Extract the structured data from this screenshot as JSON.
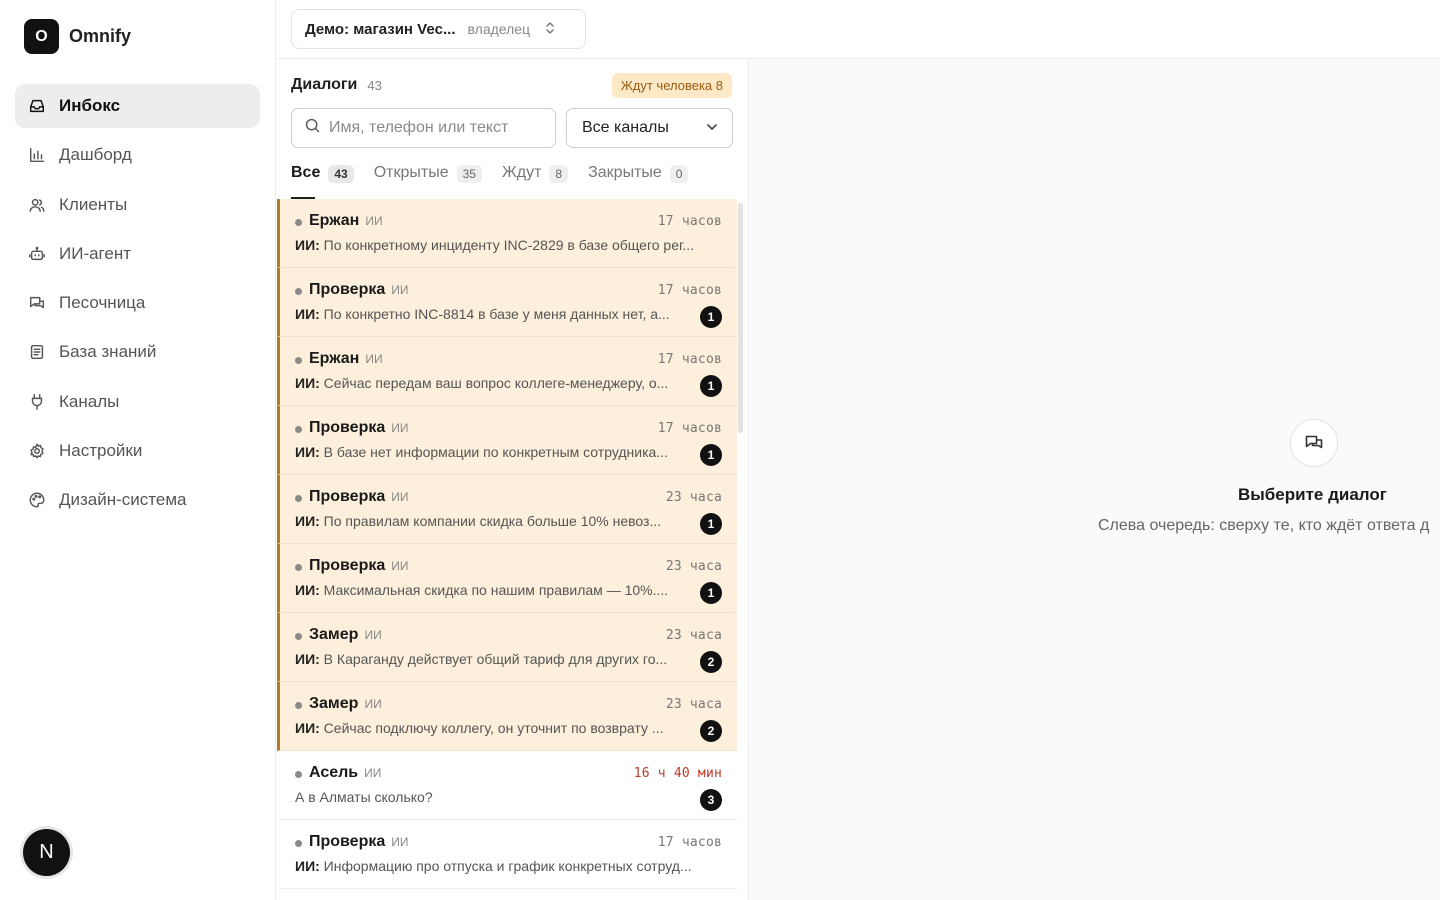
{
  "brand": {
    "logo_letter": "O",
    "name": "Omnify"
  },
  "nav": [
    {
      "label": "Инбокс",
      "icon": "inbox-icon",
      "active": true
    },
    {
      "label": "Дашборд",
      "icon": "chart-icon"
    },
    {
      "label": "Клиенты",
      "icon": "users-icon"
    },
    {
      "label": "ИИ-агент",
      "icon": "bot-icon"
    },
    {
      "label": "Песочница",
      "icon": "chat-icon"
    },
    {
      "label": "База знаний",
      "icon": "book-icon"
    },
    {
      "label": "Каналы",
      "icon": "plug-icon"
    },
    {
      "label": "Настройки",
      "icon": "gear-icon"
    },
    {
      "label": "Дизайн-система",
      "icon": "palette-icon"
    }
  ],
  "user": {
    "avatar_letter": "N"
  },
  "org": {
    "name": "Демо: магазин Vec...",
    "role": "владелец"
  },
  "dialogs": {
    "title": "Диалоги",
    "count": "43",
    "waiting_badge": "Ждут человека 8",
    "search_placeholder": "Имя, телефон или текст",
    "channel_filter": "Все каналы",
    "tabs": [
      {
        "label": "Все",
        "count": "43",
        "active": true
      },
      {
        "label": "Открытые",
        "count": "35"
      },
      {
        "label": "Ждут",
        "count": "8"
      },
      {
        "label": "Закрытые",
        "count": "0"
      }
    ],
    "rows": [
      {
        "name": "Ержан",
        "tag": "ИИ",
        "time": "17 часов",
        "prefix": "ИИ:",
        "preview": " По конкретному инциденту INC-2829 в базе общего рег...",
        "unread": "",
        "waiting": true
      },
      {
        "name": "Проверка",
        "tag": "ИИ",
        "time": "17 часов",
        "prefix": "ИИ:",
        "preview": " По конкретно INC-8814 в базе у меня данных нет, а...",
        "unread": "1",
        "waiting": true
      },
      {
        "name": "Ержан",
        "tag": "ИИ",
        "time": "17 часов",
        "prefix": "ИИ:",
        "preview": " Сейчас передам ваш вопрос коллеге-менеджеру, о...",
        "unread": "1",
        "waiting": true
      },
      {
        "name": "Проверка",
        "tag": "ИИ",
        "time": "17 часов",
        "prefix": "ИИ:",
        "preview": " В базе нет информации по конкретным сотрудника...",
        "unread": "1",
        "waiting": true
      },
      {
        "name": "Проверка",
        "tag": "ИИ",
        "time": "23 часа",
        "prefix": "ИИ:",
        "preview": " По правилам компании скидка больше 10% невоз...",
        "unread": "1",
        "waiting": true
      },
      {
        "name": "Проверка",
        "tag": "ИИ",
        "time": "23 часа",
        "prefix": "ИИ:",
        "preview": " Максимальная скидка по нашим правилам — 10%....",
        "unread": "1",
        "waiting": true
      },
      {
        "name": "Замер",
        "tag": "ИИ",
        "time": "23 часа",
        "prefix": "ИИ:",
        "preview": " В Караганду действует общий тариф для других го...",
        "unread": "2",
        "waiting": true
      },
      {
        "name": "Замер",
        "tag": "ИИ",
        "time": "23 часа",
        "prefix": "ИИ:",
        "preview": " Сейчас подключу коллегу, он уточнит по возврату ...",
        "unread": "2",
        "waiting": true
      },
      {
        "name": "Асель",
        "tag": "ИИ",
        "time": "16 ч 40 мин",
        "time_red": true,
        "prefix": "",
        "preview": "А в Алматы сколько?",
        "unread": "3",
        "waiting": false
      },
      {
        "name": "Проверка",
        "tag": "ИИ",
        "time": "17 часов",
        "prefix": "ИИ:",
        "preview": " Информацию про отпуска и график конкретных сотруд...",
        "unread": "",
        "waiting": false
      }
    ]
  },
  "empty_state": {
    "icon": "chat-bubbles-icon",
    "title": "Выберите диалог",
    "subtitle": "Слева очередь: сверху те, кто ждёт ответа д"
  },
  "colors": {
    "waiting_bg": "#fcf0dc",
    "waiting_accent": "#b07c2c",
    "badge_bg": "#fde9c6",
    "badge_text": "#9a5b12"
  }
}
